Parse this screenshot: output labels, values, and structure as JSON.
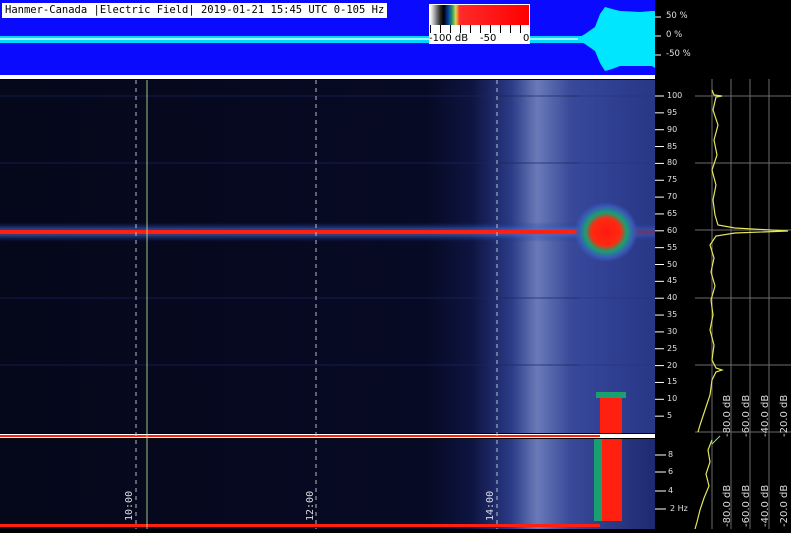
{
  "title": "Hanmer-Canada |Electric Field| 2019-01-21 15:45 UTC 0-105 Hz",
  "colorbar": {
    "labels": [
      "-100 dB",
      "-50",
      "0"
    ]
  },
  "amplitude_axis": {
    "ticks": [
      "50 %",
      "0 %",
      "-50 %"
    ]
  },
  "frequency_axis": {
    "ticks": [
      "100",
      "95",
      "90",
      "85",
      "80",
      "75",
      "70",
      "65",
      "60",
      "55",
      "50",
      "45",
      "40",
      "35",
      "30",
      "25",
      "20",
      "15",
      "10",
      "5"
    ],
    "zoom_ticks": [
      "8",
      "6",
      "4",
      "2 Hz"
    ]
  },
  "time_axis": {
    "labels": [
      "10:00",
      "12:00",
      "14:00"
    ]
  },
  "spectrum_axis": {
    "labels": [
      "-80.0 dB",
      "-60.0 dB",
      "-40.0 dB",
      "-20.0 dB"
    ]
  },
  "colors": {
    "band": "#ff2010",
    "trace": "#dede50",
    "waveform": "#00e6ff",
    "panel": "#0a0aff"
  }
}
